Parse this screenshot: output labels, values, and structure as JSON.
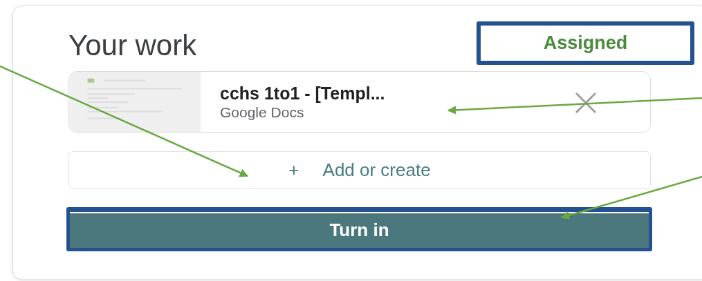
{
  "title": "Your work",
  "status": "Assigned",
  "attachment": {
    "title": "cchs 1to1 - [Templ...",
    "type": "Google Docs"
  },
  "add_button": {
    "icon": "+",
    "label": "Add or create"
  },
  "turn_in_button": "Turn in"
}
